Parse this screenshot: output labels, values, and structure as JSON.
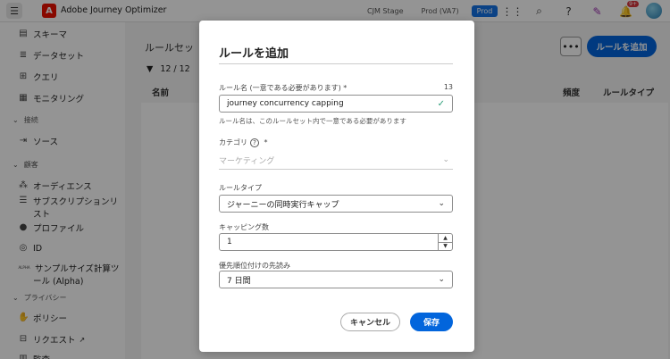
{
  "topbar": {
    "app_name": "Adobe Journey Optimizer",
    "logo_letter": "A",
    "environments": [
      "CJM Stage",
      "Prod (VA7)",
      "Prod"
    ],
    "notification_badge": "9+"
  },
  "sidebar": {
    "items": [
      {
        "label": "スキーマ",
        "icon": "schema-icon"
      },
      {
        "label": "データセット",
        "icon": "dataset-icon"
      },
      {
        "label": "クエリ",
        "icon": "query-icon"
      },
      {
        "label": "モニタリング",
        "icon": "monitoring-icon"
      }
    ],
    "section_connections": "接続",
    "sources_label": "ソース",
    "section_customers": "顧客",
    "audiences_label": "オーディエンス",
    "subscription_lists_label_1": "サブスクリプションリ",
    "subscription_lists_label_2": "スト",
    "profiles_label": "プロファイル",
    "id_label": "ID",
    "sample_size_label_1": "サンプルサイズ計算ツ",
    "sample_size_label_2": "ール (Alpha)",
    "alpha_tag": "ALPHA",
    "section_privacy": "プライバシー",
    "policies_label": "ポリシー",
    "requests_label": "リクエスト",
    "audit_label": "監査"
  },
  "main": {
    "title": "ルールセッ",
    "add_rule_button": "ルールを追加",
    "more_button": "•••",
    "filter_count": "12 / 12",
    "col_name": "名前",
    "col_frequency": "頻度",
    "col_rule_type": "ルールタイプ"
  },
  "dialog": {
    "title": "ルールを追加",
    "rule_name_label": "ルール名 (一意である必要があります) *",
    "rule_name_count": "13",
    "rule_name_value": "journey concurrency capping",
    "rule_name_help": "ルール名は、このルールセット内で一意である必要があります",
    "category_label": "カテゴリ",
    "category_required": "*",
    "category_value": "マーケティング",
    "rule_type_label": "ルールタイプ",
    "rule_type_value": "ジャーニーの同時実行キャップ",
    "capping_count_label": "キャッピング数",
    "capping_count_value": "1",
    "lookahead_label": "優先順位付けの先読み",
    "lookahead_value": "7 日間",
    "cancel_button": "キャンセル",
    "save_button": "保存"
  }
}
